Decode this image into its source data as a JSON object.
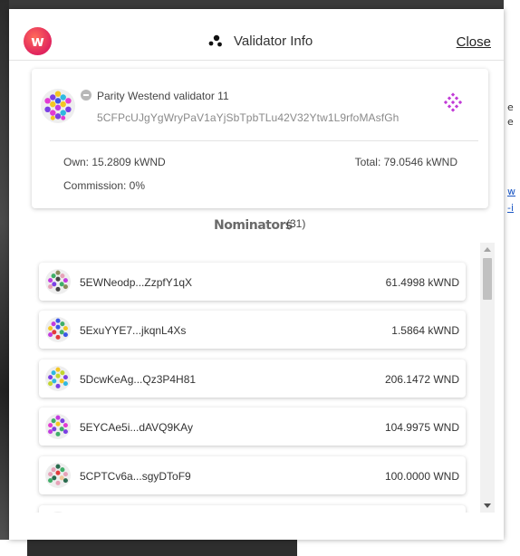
{
  "header": {
    "title": "Validator Info",
    "close_label": "Close",
    "logo_letter": "w"
  },
  "validator": {
    "name": "Parity Westend validator 11",
    "address": "5CFPcUJgYgWryPaV1aYjSbTpbTLu42V32Ytw1L9rfoMAsfGh",
    "own": "Own: 15.2809 kWND",
    "total": "Total: 79.0546 kWND",
    "commission": "Commission: 0%"
  },
  "nominators": {
    "title": "Nominators",
    "count": "(31)",
    "items": [
      {
        "address": "5EWNeodp...ZzpfY1qX",
        "amount": "61.4998 kWND"
      },
      {
        "address": "5ExuYYE7...jkqnL4Xs",
        "amount": "1.5864 kWND"
      },
      {
        "address": "5DcwKeAg...Qz3P4H81",
        "amount": "206.1472 WND"
      },
      {
        "address": "5EYCAe5i...dAVQ9KAy",
        "amount": "104.9975 WND"
      },
      {
        "address": "5CPTCv6a...sgyDToF9",
        "amount": "100.0000 WND"
      },
      {
        "address": "",
        "amount": ""
      }
    ]
  },
  "background": {
    "right_fragments": [
      "e",
      "e",
      "w",
      "-i"
    ]
  },
  "colors": {
    "accent": "#e6007a",
    "logo": "#e0245e",
    "grid_icon": "#c13ad6"
  },
  "icons": {
    "title": "nodes-icon",
    "validator_action": "grid-diamond-icon",
    "status": "inactive-status-icon"
  }
}
